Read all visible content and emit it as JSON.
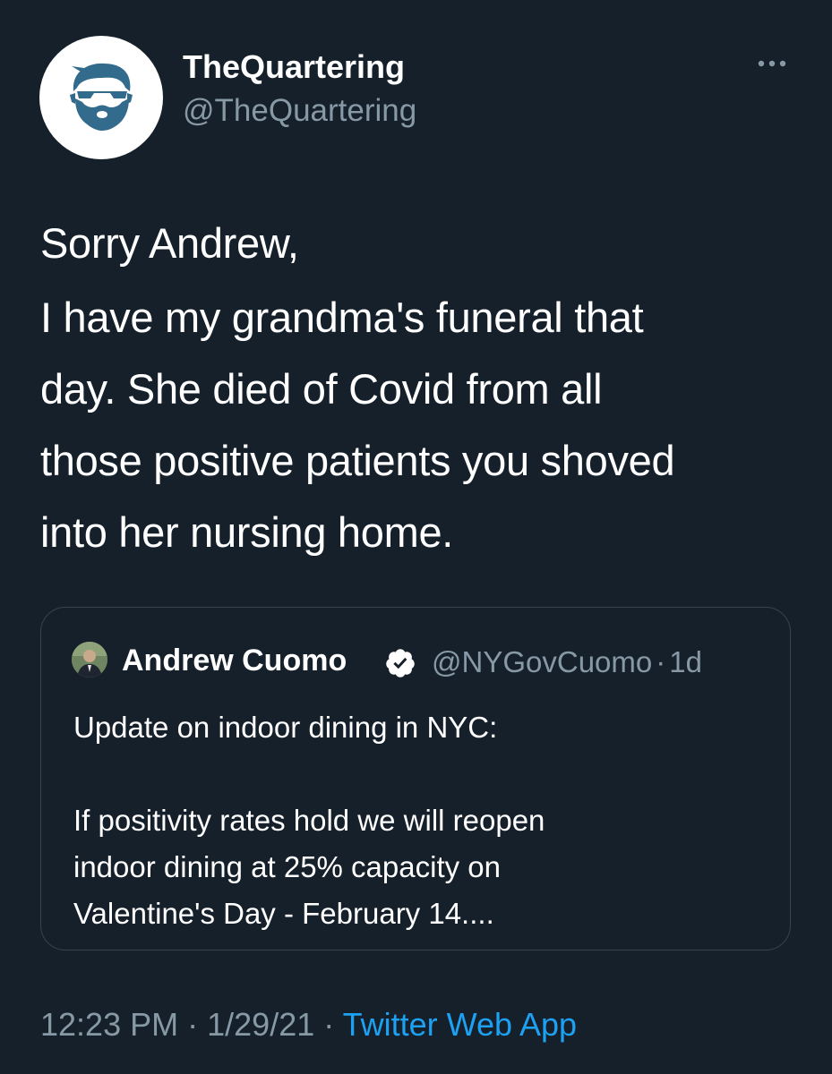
{
  "author": {
    "name": "TheQuartering",
    "handle": "@TheQuartering"
  },
  "tweet": {
    "lines_p1": [
      "Sorry Andrew,"
    ],
    "lines_p2": [
      "I have my grandma's funeral that",
      "day.  She died of Covid from all",
      "those positive patients you shoved",
      "into her nursing home."
    ]
  },
  "quote": {
    "name": "Andrew Cuomo",
    "handle": "@NYGovCuomo",
    "separator": "·",
    "age": "1d",
    "lines_p1": [
      "Update on indoor dining in NYC:"
    ],
    "lines_p2": [
      "If positivity rates hold we will reopen",
      "indoor dining at 25% capacity on",
      "Valentine's Day - February 14...."
    ]
  },
  "meta": {
    "time": "12:23 PM",
    "sep1": "·",
    "date": "1/29/21",
    "sep2": "·",
    "source": "Twitter Web App"
  },
  "colors": {
    "background": "#15202b",
    "secondary_text": "#8899a6",
    "link": "#1da1f2",
    "border": "#38444d",
    "verified_badge": "#ffffff"
  },
  "icons": {
    "more": "more-horizontal-icon",
    "verified": "verified-badge-icon"
  }
}
